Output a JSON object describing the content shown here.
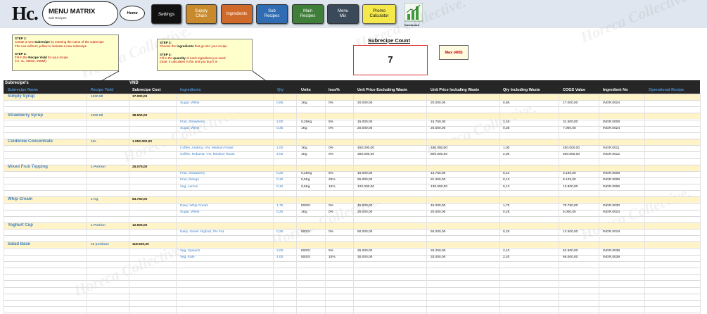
{
  "logo": "Hc.",
  "title": {
    "main": "MENU MATRIX",
    "sub": "Sub Recipes"
  },
  "nav": {
    "home": "Home",
    "settings": "Settings",
    "supply_chain": [
      "Supply",
      "Chain"
    ],
    "ingredients": "Ingredients",
    "sub_recipes": [
      "Sub",
      "Recipes"
    ],
    "main_recipes": [
      "Main",
      "Recipes"
    ],
    "menu_mix": [
      "Menu",
      "Mix"
    ],
    "promo": [
      "Promo",
      "Calculator"
    ],
    "dashboard": "Dashboard"
  },
  "colors": {
    "settings": "#111111",
    "supply_chain": "#c98a2d",
    "ingredients": "#d06a2a",
    "sub_recipes": "#2f6cb3",
    "main_recipes": "#3f7f3a",
    "menu_mix": "#3b4a5a",
    "promo": "#f4e84a",
    "header": "#262626",
    "recipe_band": "#fff3c8",
    "link_blue": "#3d7fc6",
    "accent_red": "#c00000"
  },
  "steps_left": {
    "step1_label": "STEP 1:",
    "step1_text_a": "Create a new ",
    "step1_bold": "Subrecipe",
    "step1_text_b": " by entering the name of the subrecipe",
    "step1_line2": "The row will turn yellow to indicate a new subrecipe",
    "step2_label": "STEP 2:",
    "step2_text_a": "Fill in the ",
    "step2_bold": "Recipe Yield",
    "step2_text_b": " for your recipe",
    "step2_line2": "(i.e. 1L, 500Gr, 250Ml)"
  },
  "steps_right": {
    "step3_label": "STEP 3:",
    "step3_text_a": "Choose the ",
    "step3_bold": "ingredients",
    "step3_text_b": " that go into your recipe",
    "step4_label": "STEP 4:",
    "step4_text_a": "Fill in the ",
    "step4_bold": "quantity",
    "step4_text_b": " of each ingredient you need",
    "step4_line2": "(note: it calculates in the unit you buy it in"
  },
  "subrecipe_count": {
    "label": "Subrecipe Count",
    "value": "7",
    "max": "Max (400)"
  },
  "table": {
    "group_label": "Subrecipe's",
    "currency": "VND",
    "headers": {
      "name": "Subrecipe Name",
      "yield": "Recipe Yield",
      "cost": "Subrecipe Cost",
      "ingredients": "Ingredients",
      "qty": "Qty",
      "units": "Units",
      "loss": "loss%",
      "price_ex": "Unit Price Excluding Waste",
      "price_in": "Unit Price Including Waste",
      "qty_in": "Qty Including Waste",
      "cogs": "COGS Value",
      "ing_no": "Ingredient No",
      "op_recipe": "Operational Recipe"
    },
    "recipes": [
      {
        "name": "Simply Syrup",
        "yield": "1000 Ml",
        "cost": "17.000,00",
        "items": [
          {
            "ingredient": "Sugar, White",
            "qty": "0,85",
            "unit": "1Kg",
            "loss": "0%",
            "price_ex": "20.000,00",
            "price_in": "20.000,00",
            "qty_in": "0,85",
            "cogs": "17.000,00",
            "ing_no": "INGR.0024"
          }
        ]
      },
      {
        "name": "Strawberry Syrup",
        "yield": "1000 Ml",
        "cost": "38.500,00",
        "items": [
          {
            "ingredient": "Fruit, Strawberry",
            "qty": "2,00",
            "unit": "0,25Kg",
            "loss": "5%",
            "price_ex": "15.000,00",
            "price_in": "15.750,00",
            "qty_in": "2,10",
            "cogs": "31.500,00",
            "ing_no": "INGR.0008"
          },
          {
            "ingredient": "Sugar, White",
            "qty": "0,35",
            "unit": "1Kg",
            "loss": "0%",
            "price_ex": "20.000,00",
            "price_in": "20.000,00",
            "qty_in": "0,35",
            "cogs": "7.000,00",
            "ing_no": "INGR.0024"
          }
        ]
      },
      {
        "name": "Coldbrew Concentrate",
        "yield": "10L",
        "cost": "1.050.000,00",
        "items": [
          {
            "ingredient": "Coffee, Arabica, VN, Medium Roast",
            "qty": "1,00",
            "unit": "1Kg",
            "loss": "0%",
            "price_ex": "450.000,00",
            "price_in": "450.000,00",
            "qty_in": "1,00",
            "cogs": "450.000,00",
            "ing_no": "INGR.0011"
          },
          {
            "ingredient": "Coffee, Robusta, VN, Medium Roast",
            "qty": "2,00",
            "unit": "1Kg",
            "loss": "0%",
            "price_ex": "300.000,00",
            "price_in": "300.000,00",
            "qty_in": "2,00",
            "cogs": "600.000,00",
            "ing_no": "INGR.0012"
          }
        ]
      },
      {
        "name": "Mixed Fruit Topping",
        "yield": "1 Portion",
        "cost": "25.075,00",
        "items": [
          {
            "ingredient": "Fruit, Strawberry",
            "qty": "0,20",
            "unit": "0,25Kg",
            "loss": "5%",
            "price_ex": "15.000,00",
            "price_in": "15.750,00",
            "qty_in": "0,21",
            "cogs": "3.150,00",
            "ing_no": "INGR.0008"
          },
          {
            "ingredient": "Fruit, Mango",
            "qty": "0,10",
            "unit": "0,5Kg",
            "loss": "25%",
            "price_ex": "65.000,00",
            "price_in": "81.250,00",
            "qty_in": "0,13",
            "cogs": "8.125,00",
            "ing_no": "INGR.0009"
          },
          {
            "ingredient": "Veg, Lemon",
            "qty": "0,10",
            "unit": "0,5Kg",
            "loss": "15%",
            "price_ex": "120.000,00",
            "price_in": "138.000,00",
            "qty_in": "0,12",
            "cogs": "13.800,00",
            "ing_no": "INGR.0006"
          }
        ]
      },
      {
        "name": "Whip Cream",
        "yield": "1 Kg",
        "cost": "83.750,00",
        "items": [
          {
            "ingredient": "Dairy, Whip Cream",
            "qty": "1,75",
            "unit": "500Gr",
            "loss": "0%",
            "price_ex": "45.000,00",
            "price_in": "45.000,00",
            "qty_in": "1,75",
            "cogs": "78.750,00",
            "ing_no": "INGR.0030"
          },
          {
            "ingredient": "Sugar, White",
            "qty": "0,25",
            "unit": "1Kg",
            "loss": "0%",
            "price_ex": "20.000,00",
            "price_in": "20.000,00",
            "qty_in": "0,25",
            "cogs": "5.000,00",
            "ing_no": "INGR.0024"
          }
        ]
      },
      {
        "name": "Yoghurt Cup",
        "yield": "1 Portion",
        "cost": "12.500,00",
        "items": [
          {
            "ingredient": "Dairy, Greek Yoghurt, 0% Fat",
            "qty": "0,25",
            "unit": "500Gr",
            "loss": "0%",
            "price_ex": "50.000,00",
            "price_in": "50.000,00",
            "qty_in": "0,25",
            "cogs": "12.500,00",
            "ing_no": "INGR.0018"
          }
        ]
      },
      {
        "name": "Salad Base",
        "yield": "10 portions",
        "cost": "118.500,00",
        "items": [
          {
            "ingredient": "Veg, Spinach",
            "qty": "2,00",
            "unit": "500Gr",
            "loss": "5%",
            "price_ex": "25.000,00",
            "price_in": "26.250,00",
            "qty_in": "2,10",
            "cogs": "52.500,00",
            "ing_no": "INGR.0038"
          },
          {
            "ingredient": "Veg, Kale",
            "qty": "2,00",
            "unit": "500Gr",
            "loss": "10%",
            "price_ex": "30.000,00",
            "price_in": "33.000,00",
            "qty_in": "2,20",
            "cogs": "66.000,00",
            "ing_no": "INGR.0039"
          }
        ]
      }
    ]
  }
}
